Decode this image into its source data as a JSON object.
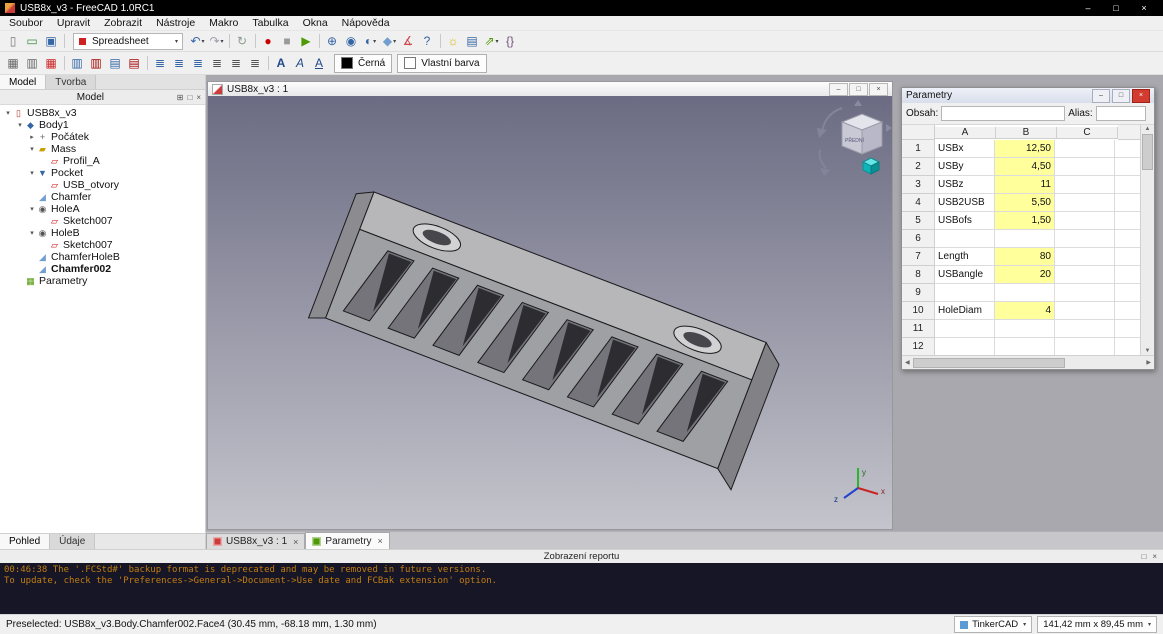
{
  "titlebar": {
    "title": "USB8x_v3 - FreeCAD 1.0RC1"
  },
  "icons": {
    "minimize": "–",
    "maximize": "□",
    "close": "×",
    "dropdown": "▾",
    "up": "▲",
    "down": "▼",
    "left": "◀",
    "right": "▶",
    "home": "⌂"
  },
  "menubar": {
    "items": [
      "Soubor",
      "Upravit",
      "Zobrazit",
      "Nástroje",
      "Makro",
      "Tabulka",
      "Okna",
      "Nápověda"
    ]
  },
  "toolbar1": {
    "workbench": "Spreadsheet",
    "group_a": [
      {
        "name": "new-file-icon",
        "glyph": "▯",
        "color": "#777777"
      },
      {
        "name": "open-file-icon",
        "glyph": "▭",
        "color": "#3e8e41"
      },
      {
        "name": "save-icon",
        "glyph": "▣",
        "color": "#3465a4"
      },
      {
        "sep": true
      }
    ],
    "group_b": [
      {
        "name": "undo-icon",
        "glyph": "↶",
        "color": "#3465a4",
        "dd": "▾"
      },
      {
        "name": "redo-icon",
        "glyph": "↷",
        "color": "#9aa0a8",
        "dd": "▾"
      },
      {
        "sep": true
      },
      {
        "name": "refresh-icon",
        "glyph": "↻",
        "color": "#8a9a8a"
      },
      {
        "sep": true
      },
      {
        "name": "record-macro-icon",
        "glyph": "●",
        "color": "#cc0000"
      },
      {
        "name": "stop-macro-icon",
        "glyph": "■",
        "color": "#9a9a9a"
      },
      {
        "name": "execute-macro-icon",
        "glyph": "▶",
        "color": "#4e9a06"
      },
      {
        "sep": true
      },
      {
        "name": "zoom-fit-icon",
        "glyph": "⊕",
        "color": "#3465a4"
      },
      {
        "name": "zoom-selection-icon",
        "glyph": "◉",
        "color": "#3465a4"
      },
      {
        "name": "draw-style-icon",
        "glyph": "◐",
        "color": "#3465a4",
        "dd": "▾"
      },
      {
        "name": "view-isometric-icon",
        "glyph": "◆",
        "color": "#729fcf",
        "dd": "▾"
      },
      {
        "name": "measure-icon",
        "glyph": "∡",
        "color": "#cc4444"
      },
      {
        "name": "whats-this-icon",
        "glyph": "?",
        "color": "#3465a4"
      },
      {
        "sep": true
      },
      {
        "name": "appearance-icon",
        "glyph": "☼",
        "color": "#d8b400"
      },
      {
        "name": "spreadsheet-view-icon",
        "glyph": "▤",
        "color": "#3465a4"
      },
      {
        "name": "export-icon",
        "glyph": "⇗",
        "color": "#4e9a06",
        "dd": "▾"
      },
      {
        "name": "expression-icon",
        "glyph": "{}",
        "color": "#75507b"
      }
    ]
  },
  "toolbar2": {
    "items": [
      {
        "name": "merge-cells-icon",
        "glyph": "▦",
        "color": "#666666"
      },
      {
        "name": "split-cell-icon",
        "glyph": "▥",
        "color": "#666666"
      },
      {
        "name": "export-csv-icon",
        "glyph": "▦",
        "color": "#cc2222"
      },
      {
        "sep": true
      },
      {
        "name": "insert-column-icon",
        "glyph": "▥",
        "color": "#3465a4"
      },
      {
        "name": "remove-column-icon",
        "glyph": "▥",
        "color": "#a40000"
      },
      {
        "name": "insert-row-icon",
        "glyph": "▤",
        "color": "#3465a4"
      },
      {
        "name": "remove-row-icon",
        "glyph": "▤",
        "color": "#a40000"
      },
      {
        "sep": true
      },
      {
        "name": "align-left-icon",
        "glyph": "≣",
        "color": "#3465a4"
      },
      {
        "name": "align-center-icon",
        "glyph": "≣",
        "color": "#3465a4"
      },
      {
        "name": "align-right-icon",
        "glyph": "≣",
        "color": "#3465a4"
      },
      {
        "name": "align-top-icon",
        "glyph": "≣",
        "color": "#555555"
      },
      {
        "name": "align-vcenter-icon",
        "glyph": "≣",
        "color": "#555555"
      },
      {
        "name": "align-bottom-icon",
        "glyph": "≣",
        "color": "#555555"
      },
      {
        "sep": true
      },
      {
        "name": "style-bold-icon",
        "glyph": "A",
        "color": "#204a87",
        "cls": "b"
      },
      {
        "name": "style-italic-icon",
        "glyph": "A",
        "color": "#204a87",
        "cls": "i"
      },
      {
        "name": "style-underline-icon",
        "glyph": "A",
        "color": "#204a87",
        "cls": "u"
      }
    ],
    "fg_color_label": "Černá",
    "bg_color_label": "Vlastní barva"
  },
  "left_panel": {
    "tabs": [
      {
        "label": "Model",
        "active": true
      },
      {
        "label": "Tvorba",
        "active": false
      }
    ],
    "header": "Model",
    "header_icons": [
      {
        "name": "panel-menu-icon",
        "glyph": "⊞"
      },
      {
        "name": "panel-float-icon",
        "glyph": "□"
      },
      {
        "name": "panel-close-icon",
        "glyph": "×"
      }
    ],
    "tree": [
      {
        "label": "USB8x_v3",
        "depth": 0,
        "arrow": "▾",
        "name": "document-icon",
        "glyph": "▯",
        "color": "#b43c3c"
      },
      {
        "label": "Body1",
        "depth": 1,
        "arrow": "▾",
        "name": "body-icon",
        "glyph": "◆",
        "color": "#3465a4"
      },
      {
        "label": "Počátek",
        "depth": 2,
        "arrow": "▸",
        "name": "origin-icon",
        "glyph": "+",
        "color": "#666666"
      },
      {
        "label": "Mass",
        "depth": 2,
        "arrow": "▾",
        "name": "pad-icon",
        "glyph": "▰",
        "color": "#c4a000"
      },
      {
        "label": "Profil_A",
        "depth": 3,
        "arrow": "",
        "name": "sketch-icon",
        "glyph": "▱",
        "color": "#cc0000"
      },
      {
        "label": "Pocket",
        "depth": 2,
        "arrow": "▾",
        "name": "pocket-icon",
        "glyph": "▼",
        "color": "#3465a4"
      },
      {
        "label": "USB_otvory",
        "depth": 3,
        "arrow": "",
        "name": "sketch-icon",
        "glyph": "▱",
        "color": "#cc0000"
      },
      {
        "label": "Chamfer",
        "depth": 2,
        "arrow": "",
        "name": "chamfer-icon",
        "glyph": "◢",
        "color": "#729fcf"
      },
      {
        "label": "HoleA",
        "depth": 2,
        "arrow": "▾",
        "name": "hole-icon",
        "glyph": "◉",
        "color": "#555555"
      },
      {
        "label": "Sketch007",
        "depth": 3,
        "arrow": "",
        "name": "sketch-icon",
        "glyph": "▱",
        "color": "#cc0000"
      },
      {
        "label": "HoleB",
        "depth": 2,
        "arrow": "▾",
        "name": "hole-icon",
        "glyph": "◉",
        "color": "#555555"
      },
      {
        "label": "Sketch007",
        "depth": 3,
        "arrow": "",
        "name": "sketch-icon",
        "glyph": "▱",
        "color": "#cc0000"
      },
      {
        "label": "ChamferHoleB",
        "depth": 2,
        "arrow": "",
        "name": "chamfer-icon",
        "glyph": "◢",
        "color": "#729fcf"
      },
      {
        "label": "Chamfer002",
        "depth": 2,
        "arrow": "",
        "name": "chamfer-icon",
        "glyph": "◢",
        "color": "#729fcf",
        "bold": true
      },
      {
        "label": "Parametry",
        "depth": 1,
        "arrow": "",
        "name": "spreadsheet-icon",
        "glyph": "▦",
        "color": "#4e9a06"
      }
    ],
    "bottom_tabs": [
      {
        "label": "Pohled",
        "active": true
      },
      {
        "label": "Údaje",
        "active": false
      }
    ]
  },
  "viewport": {
    "title": "USB8x_v3 : 1",
    "nav_cube_face": "PŘEDNÍ",
    "axis_x": "x",
    "axis_y": "y",
    "axis_z": "z"
  },
  "spreadsheet": {
    "title": "Parametry",
    "content_label": "Obsah:",
    "alias_label": "Alias:",
    "columns": [
      "A",
      "B",
      "C"
    ],
    "rows": [
      {
        "n": "1",
        "a": "USBx",
        "b": "12,50"
      },
      {
        "n": "2",
        "a": "USBy",
        "b": "4,50"
      },
      {
        "n": "3",
        "a": "USBz",
        "b": "11"
      },
      {
        "n": "4",
        "a": "USB2USB",
        "b": "5,50"
      },
      {
        "n": "5",
        "a": "USBofs",
        "b": "1,50"
      },
      {
        "n": "6",
        "a": "",
        "b": ""
      },
      {
        "n": "7",
        "a": "Length",
        "b": "80"
      },
      {
        "n": "8",
        "a": "USBangle",
        "b": "20"
      },
      {
        "n": "9",
        "a": "",
        "b": ""
      },
      {
        "n": "10",
        "a": "HoleDiam",
        "b": "4"
      },
      {
        "n": "11",
        "a": "",
        "b": ""
      },
      {
        "n": "12",
        "a": "",
        "b": ""
      }
    ]
  },
  "doc_tabs": [
    {
      "label": "USB8x_v3 : 1",
      "active": false,
      "icon_color": "#cc3b3b",
      "icon_name": "freecad-doc-icon",
      "close": "×"
    },
    {
      "label": "Parametry",
      "active": true,
      "icon_color": "#4e9a06",
      "icon_name": "spreadsheet-tab-icon",
      "close": "×"
    }
  ],
  "report": {
    "header": "Zobrazení reportu",
    "header_icons": [
      {
        "name": "report-float-icon",
        "glyph": "□"
      },
      {
        "name": "report-close-icon",
        "glyph": "×"
      }
    ],
    "lines": [
      "00:46:38  The '.FCStd#' backup format is deprecated and may be removed in future versions.",
      "To update, check the 'Preferences->General->Document->Use date and FCBak extension' option."
    ]
  },
  "statusbar": {
    "message": "Preselected: USB8x_v3.Body.Chamfer002.Face4 (30.45 mm, -68.18 mm, 1.30 mm)",
    "nav_style": "TinkerCAD",
    "dimensions": "141,42 mm x 89,45 mm"
  }
}
